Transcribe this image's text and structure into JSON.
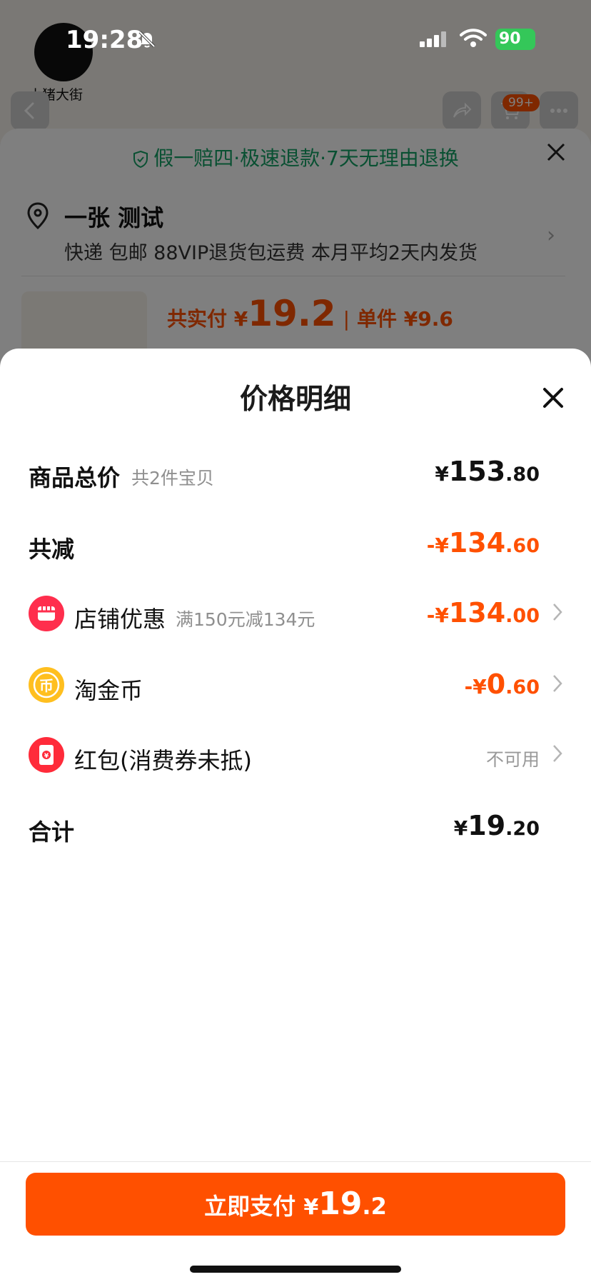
{
  "status_bar": {
    "time": "19:28",
    "battery": "90"
  },
  "background_page": {
    "shop_logo_text": "小猪大街",
    "cart_badge": "99+",
    "guarantee_text": "假一赔四·极速退款·7天无理由退换",
    "address": {
      "name": "一张 测试",
      "detail": "快递 包邮 88VIP退货包运费 本月平均2天内发货"
    },
    "product_price": {
      "total_label": "共实付 ¥",
      "total_value": "19.2",
      "unit_price": "单件 ¥9.6"
    }
  },
  "price_detail": {
    "title": "价格明细",
    "rows": [
      {
        "label": "商品总价",
        "sub": "共2件宝贝",
        "currency": "¥",
        "int": "153",
        "dec": ".80"
      },
      {
        "label": "共减",
        "currency": "-¥",
        "int": "134",
        "dec": ".60"
      },
      {
        "label": "店铺优惠",
        "sub": "满150元减134元",
        "icon": "shop-icon",
        "currency": "-¥",
        "int": "134",
        "dec": ".00"
      },
      {
        "label": "淘金币",
        "icon": "coin-icon",
        "currency": "-¥",
        "int": "0",
        "dec": ".60"
      },
      {
        "label": "红包(消费券未抵)",
        "icon": "red-packet-icon",
        "value_text": "不可用"
      },
      {
        "label": "合计",
        "currency": "¥",
        "int": "19",
        "dec": ".20"
      }
    ]
  },
  "pay_button": {
    "label": "立即支付 ",
    "currency": "¥",
    "int": "19",
    "dec": ".2"
  },
  "colors": {
    "accent": "#ff5000",
    "guarantee": "#13a065",
    "text_muted": "#8f8f8f"
  }
}
